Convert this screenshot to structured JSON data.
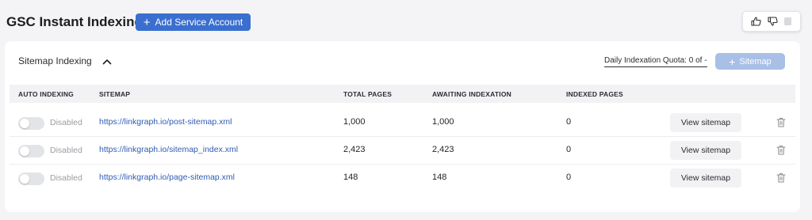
{
  "header": {
    "title": "GSC Instant Indexing",
    "add_button_label": "Add Service Account",
    "add_button_icon": "plus-icon"
  },
  "feedback": {
    "icons": [
      "thumbs-up-icon",
      "thumbs-down-icon",
      "flag-icon"
    ]
  },
  "section": {
    "title": "Sitemap Indexing",
    "collapse_icon": "chevron-up-icon",
    "quota_label": "Daily Indexation Quota:",
    "quota_value": "0 of -",
    "sitemap_button_label": "Sitemap"
  },
  "table": {
    "columns": [
      "AUTO INDEXING",
      "SITEMAP",
      "TOTAL PAGES",
      "AWAITING INDEXATION",
      "INDEXED PAGES"
    ],
    "rows": [
      {
        "status": "Disabled",
        "sitemap": "https://linkgraph.io/post-sitemap.xml",
        "total": "1,000",
        "awaiting": "1,000",
        "indexed": "0",
        "action": "View sitemap"
      },
      {
        "status": "Disabled",
        "sitemap": "https://linkgraph.io/sitemap_index.xml",
        "total": "2,423",
        "awaiting": "2,423",
        "indexed": "0",
        "action": "View sitemap"
      },
      {
        "status": "Disabled",
        "sitemap": "https://linkgraph.io/page-sitemap.xml",
        "total": "148",
        "awaiting": "148",
        "indexed": "0",
        "action": "View sitemap"
      }
    ]
  },
  "colors": {
    "primary": "#3a6fd0",
    "primary_disabled": "#a8bfe6",
    "link": "#2f5cb3",
    "page_bg": "#f4f4f6"
  }
}
